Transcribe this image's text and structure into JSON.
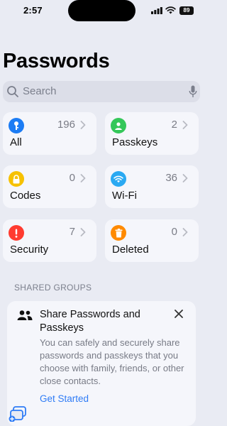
{
  "status": {
    "time": "2:57",
    "battery": "89"
  },
  "title": "Passwords",
  "search": {
    "placeholder": "Search"
  },
  "categories": [
    {
      "label": "All",
      "count": "196",
      "icon": "key-icon",
      "color": "#1c7cf4"
    },
    {
      "label": "Passkeys",
      "count": "2",
      "icon": "person-badge-icon",
      "color": "#34c759"
    },
    {
      "label": "Codes",
      "count": "0",
      "icon": "lock-icon",
      "color": "#f6c100"
    },
    {
      "label": "Wi-Fi",
      "count": "36",
      "icon": "wifi-icon",
      "color": "#2aa9f2"
    },
    {
      "label": "Security",
      "count": "7",
      "icon": "exclamation-icon",
      "color": "#ff3b30"
    },
    {
      "label": "Deleted",
      "count": "0",
      "icon": "trash-icon",
      "color": "#ff8a00"
    }
  ],
  "shared_groups": {
    "header": "SHARED GROUPS",
    "card": {
      "title": "Share Passwords and Passkeys",
      "body": "You can safely and securely share passwords and passkeys that you choose with family, friends, or other close contacts.",
      "link": "Get Started"
    }
  }
}
